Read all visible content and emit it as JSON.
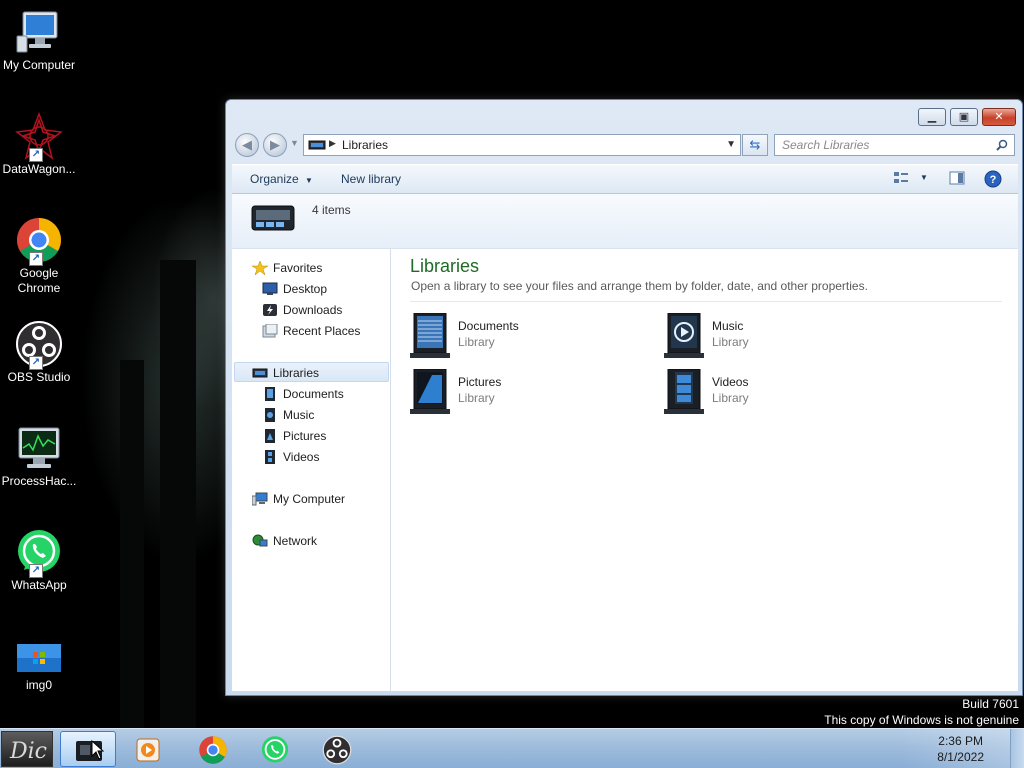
{
  "desktop": {
    "icons": [
      {
        "label": "My Computer"
      },
      {
        "label": "DataWagon..."
      },
      {
        "label": "Google Chrome"
      },
      {
        "label": "OBS Studio"
      },
      {
        "label": "ProcessHac..."
      },
      {
        "label": "WhatsApp"
      },
      {
        "label": "img0"
      }
    ],
    "watermark": {
      "line1": "Build 7601",
      "line2": "This copy of Windows is not genuine"
    }
  },
  "window": {
    "breadcrumb": "Libraries",
    "search_placeholder": "Search Libraries",
    "toolbar": {
      "organize": "Organize",
      "new_library": "New library"
    },
    "info": {
      "count": "4 items"
    },
    "nav": {
      "favorites": "Favorites",
      "desktop": "Desktop",
      "downloads": "Downloads",
      "recent_places": "Recent Places",
      "libraries": "Libraries",
      "documents": "Documents",
      "music": "Music",
      "pictures": "Pictures",
      "videos": "Videos",
      "my_computer": "My Computer",
      "network": "Network"
    },
    "main": {
      "title": "Libraries",
      "description": "Open a library to see your files and arrange them by folder, date, and other properties.",
      "libraries": [
        {
          "name": "Documents",
          "type": "Library"
        },
        {
          "name": "Music",
          "type": "Library"
        },
        {
          "name": "Pictures",
          "type": "Library"
        },
        {
          "name": "Videos",
          "type": "Library"
        }
      ]
    }
  },
  "taskbar": {
    "clock_time": "2:36 PM",
    "clock_date": "8/1/2022"
  },
  "colors": {
    "title_green": "#1e6b26",
    "taskbar_blue": "#9fbcdc",
    "close_red": "#c8412a"
  }
}
